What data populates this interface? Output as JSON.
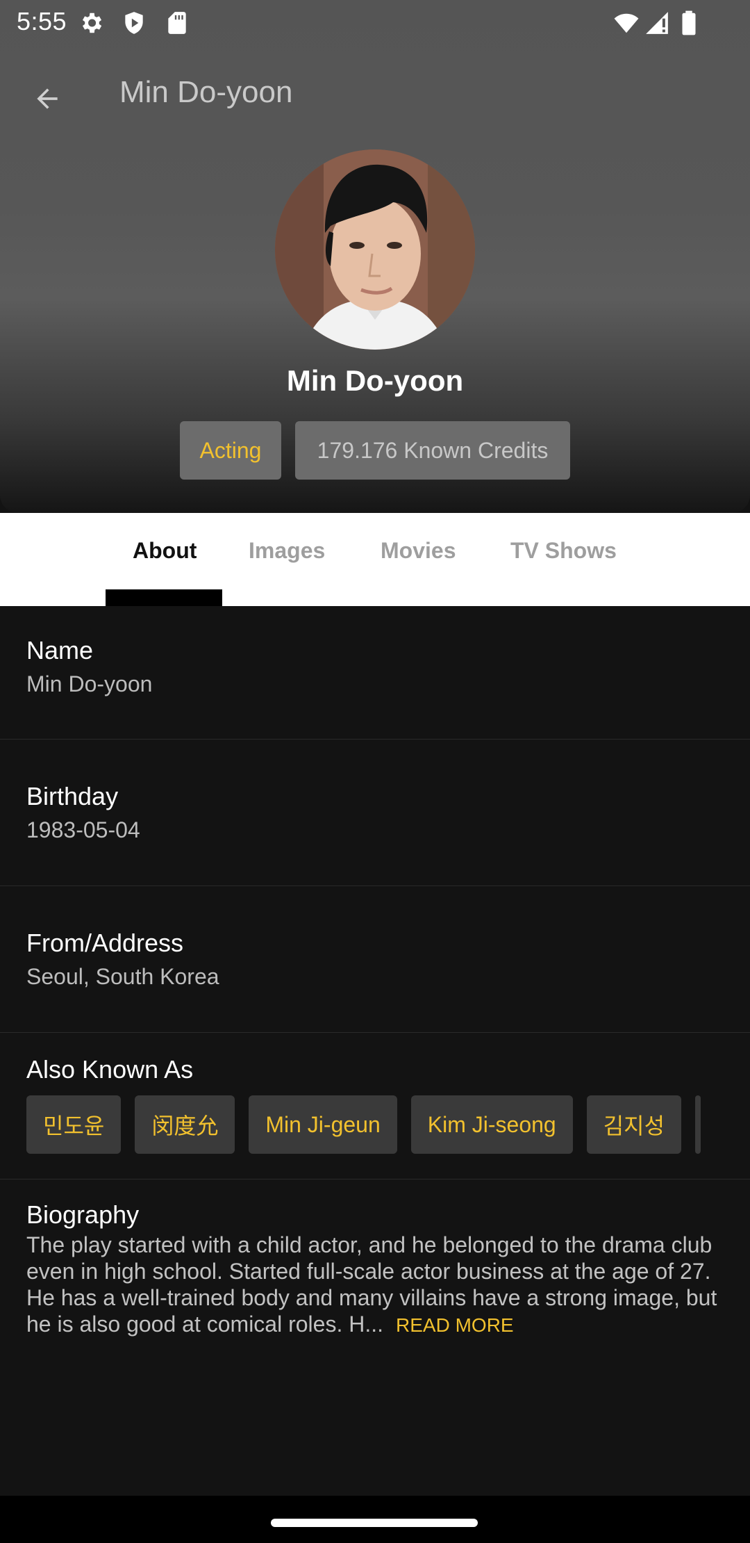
{
  "status_bar": {
    "time": "5:55",
    "icons": [
      "gear-icon",
      "shield-icon",
      "sd-card-icon",
      "wifi-icon",
      "signal-icon",
      "battery-icon"
    ]
  },
  "top_bar": {
    "back_icon": "arrow-left-icon",
    "title": "Min Do-yoon"
  },
  "profile": {
    "name": "Min Do-yoon",
    "department_chip": "Acting",
    "credits_chip": "179.176 Known Credits"
  },
  "tabs": [
    {
      "label": "About",
      "active": true
    },
    {
      "label": "Images",
      "active": false
    },
    {
      "label": "Movies",
      "active": false
    },
    {
      "label": "TV Shows",
      "active": false
    }
  ],
  "about": {
    "name_label": "Name",
    "name_value": "Min Do-yoon",
    "birthday_label": "Birthday",
    "birthday_value": "1983-05-04",
    "from_label": "From/Address",
    "from_value": "Seoul, South Korea",
    "aka_label": "Also Known As",
    "aka": [
      "민도윤",
      "闵度允",
      "Min Ji-geun",
      "Kim Ji-seong",
      "김지성"
    ],
    "bio_label": "Biography",
    "bio_text": "The play started with a child actor, and he belonged to the drama club even in high school. Started full-scale actor business at the age of 27. He has a well-trained body and many villains have a strong image, but he is also good at comical roles. H...",
    "read_more": "READ MORE"
  },
  "colors": {
    "accent": "#f2c12e",
    "background": "#131313",
    "tab_bar": "#ffffff"
  }
}
